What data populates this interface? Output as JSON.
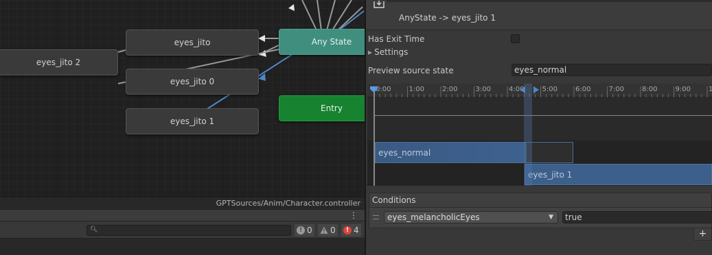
{
  "graph": {
    "nodes": {
      "eyes_jito_2": "eyes_jito 2",
      "eyes_jito": "eyes_jito",
      "eyes_jito_0": "eyes_jito 0",
      "eyes_jito_1": "eyes_jito 1",
      "any_state": "Any State",
      "entry": "Entry"
    },
    "path": "GPTSources/Anim/Character.controller"
  },
  "console": {
    "search_placeholder": "",
    "counts": {
      "info": "0",
      "warning": "0",
      "error": "4"
    }
  },
  "inspector": {
    "transition_title": "AnyState -> eyes_jito 1",
    "has_exit_time_label": "Has Exit Time",
    "settings_label": "Settings",
    "preview_label": "Preview source state",
    "preview_value": "eyes_normal",
    "timeline": {
      "ticks": [
        "0:00",
        "1:00",
        "2:00",
        "3:00",
        "4:00",
        "5:00",
        "6:00",
        "7:00",
        "8:00",
        "9:00",
        "10:00"
      ],
      "clip_source": "eyes_normal",
      "clip_target": "eyes_jito 1"
    },
    "conditions": {
      "header": "Conditions",
      "parameter": "eyes_melancholicEyes",
      "value": "true",
      "add_label": "+"
    }
  },
  "colors": {
    "any_state": "#3f8e7e",
    "entry": "#17822f",
    "clip": "#3c5f8c",
    "error": "#e0443b",
    "highlight_link": "#4f86c6"
  }
}
